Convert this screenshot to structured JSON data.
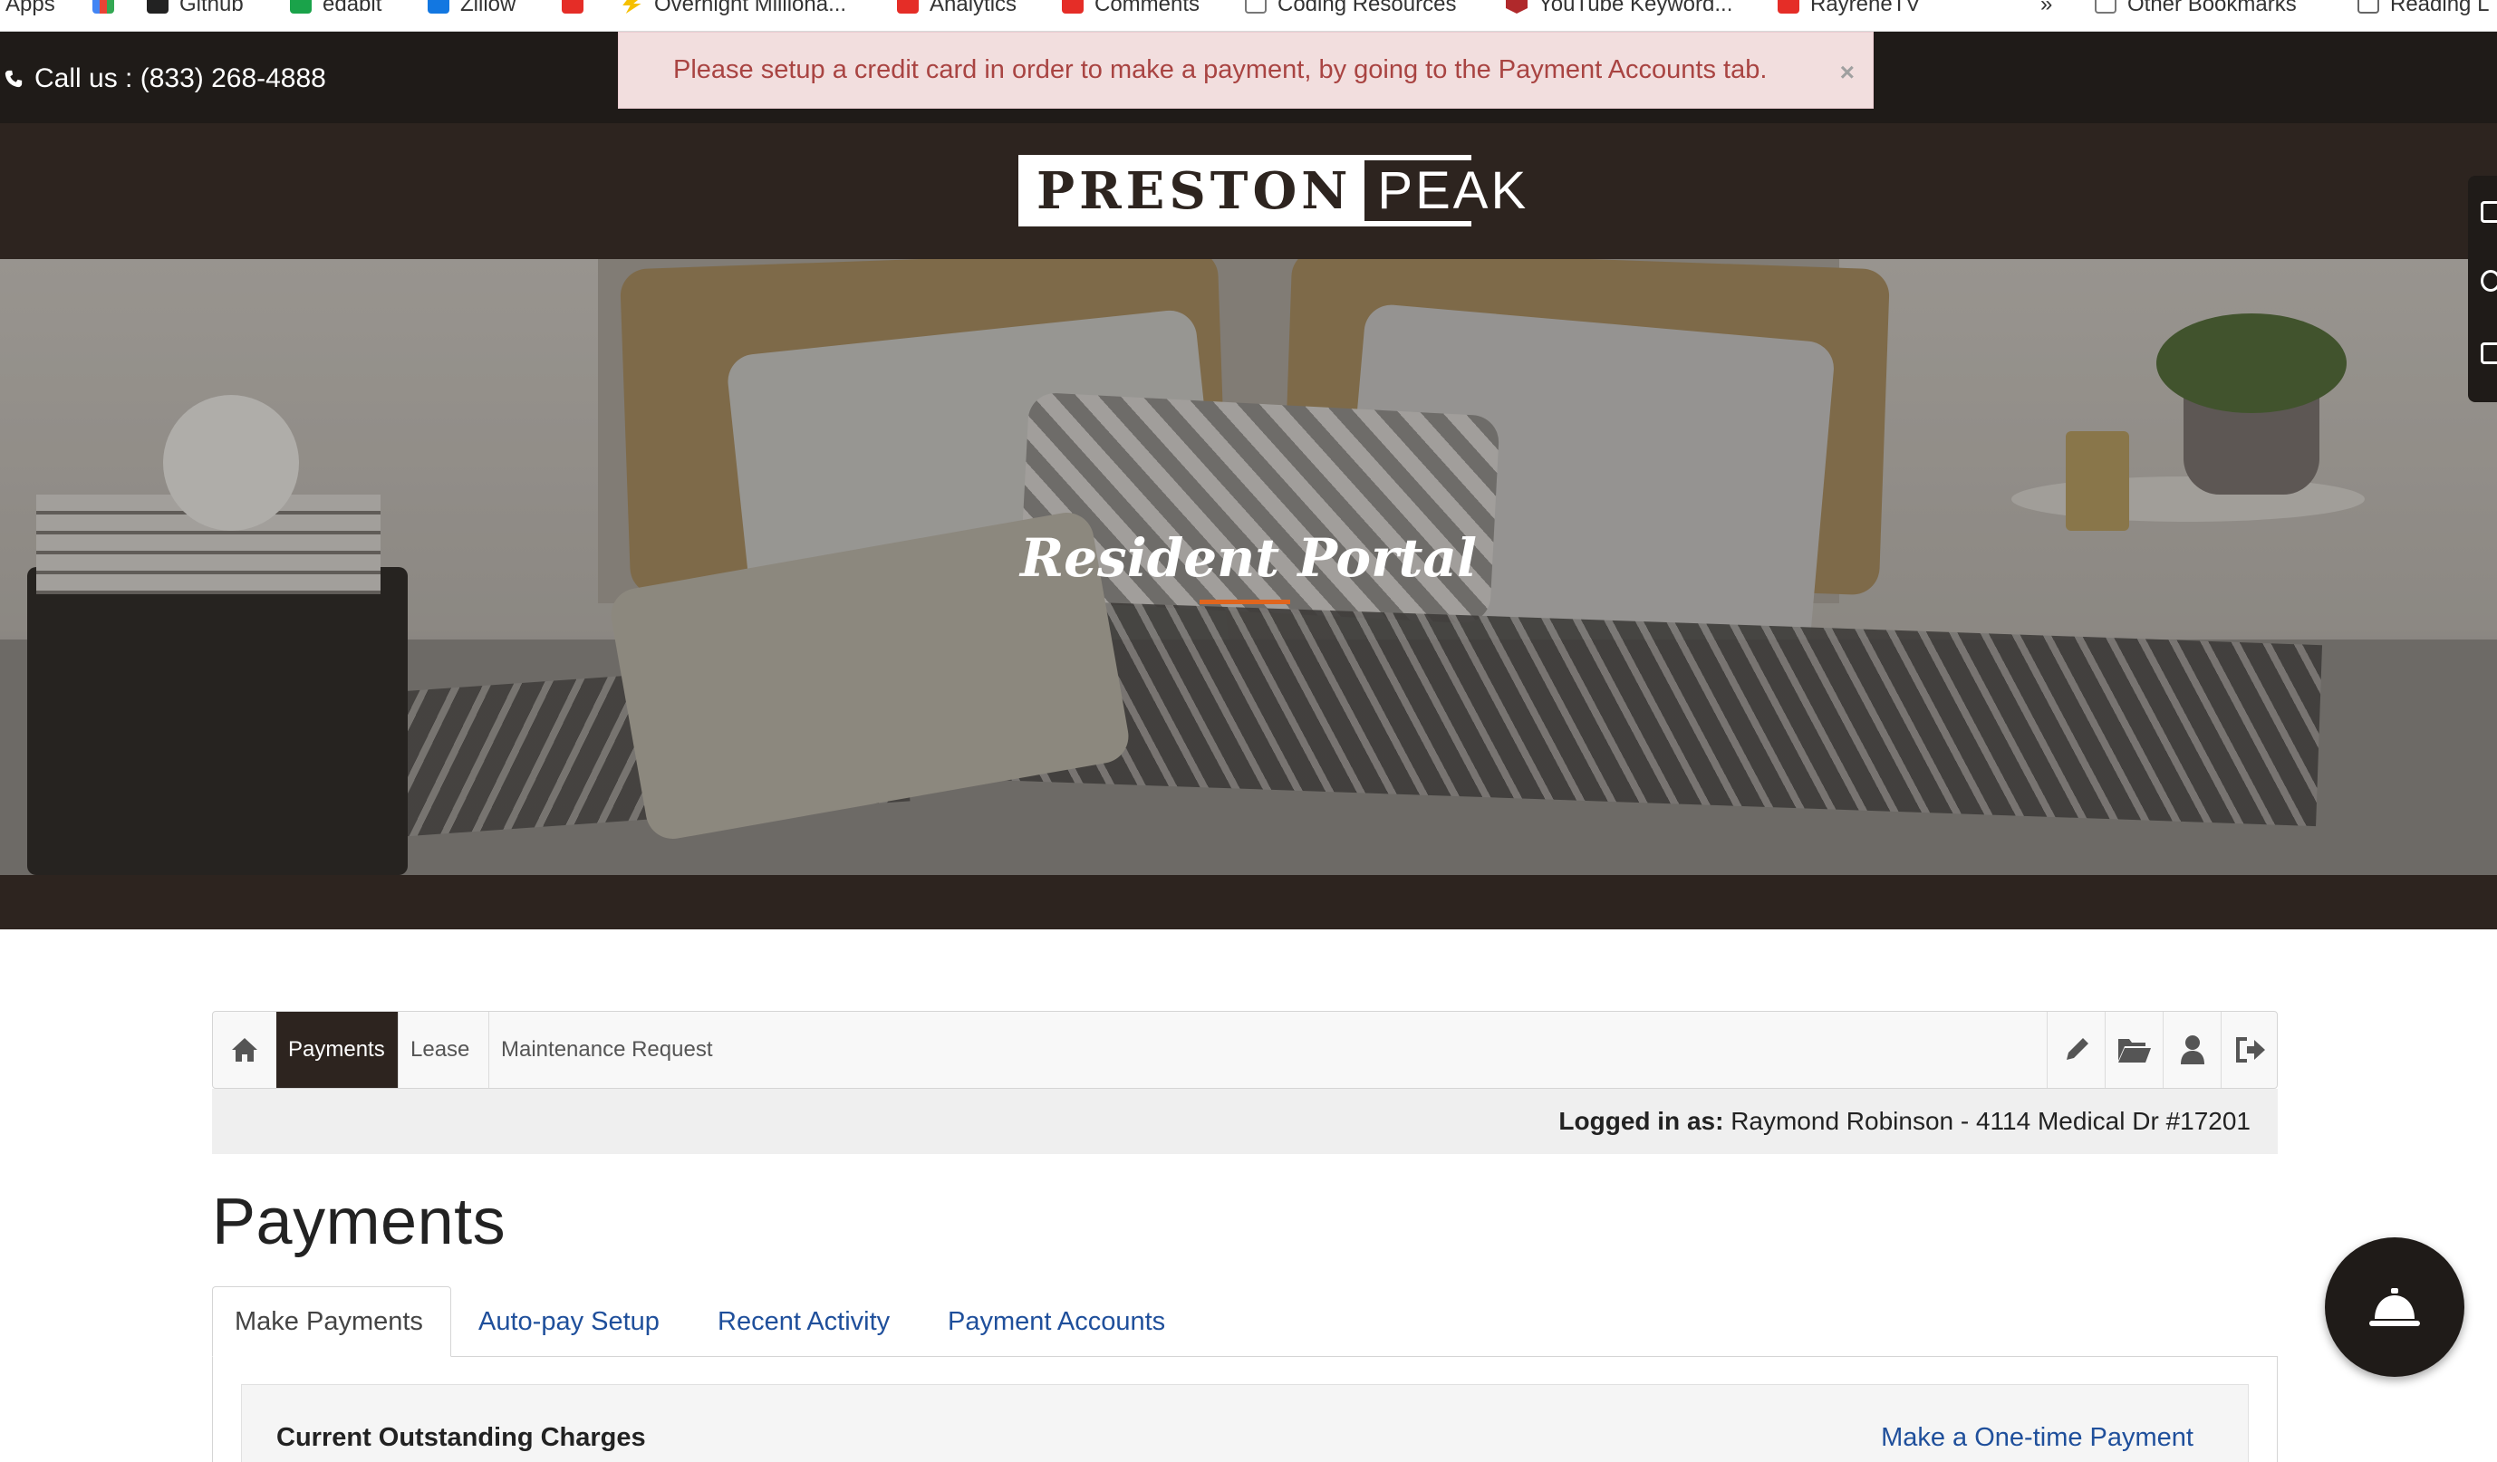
{
  "bookmarks": [
    {
      "label": "Apps",
      "icon": "apps-grid-icon"
    },
    {
      "label": "",
      "icon": "gmail-icon"
    },
    {
      "label": "Github",
      "icon": "github-icon"
    },
    {
      "label": "edabit",
      "icon": "edabit-icon"
    },
    {
      "label": "Zillow",
      "icon": "zillow-icon"
    },
    {
      "label": "",
      "icon": "youtube-icon"
    },
    {
      "label": "Overnight Milliona...",
      "icon": "bolt-icon"
    },
    {
      "label": "Analytics",
      "icon": "youtube-icon"
    },
    {
      "label": "Comments",
      "icon": "youtube-icon"
    },
    {
      "label": "Coding Resources",
      "icon": "folder-icon"
    },
    {
      "label": "YouTube Keyword...",
      "icon": "bookmark-red-icon"
    },
    {
      "label": "RayreneTV",
      "icon": "youtube-icon"
    },
    {
      "label": "»",
      "icon": ""
    },
    {
      "label": "Other Bookmarks",
      "icon": "folder-icon"
    },
    {
      "label": "Reading L",
      "icon": "reading-list-icon"
    }
  ],
  "topbar": {
    "phone": "Call us : (833) 268-4888",
    "alert": "Please setup a credit card in order to make a payment, by going to the Payment Accounts tab.",
    "alert_close": "×"
  },
  "logo": {
    "left": "PRESTON",
    "right": "PEAK"
  },
  "hero": {
    "title": "Resident Portal",
    "accent_color": "#e0651e"
  },
  "nav": {
    "items": [
      {
        "label": "Payments",
        "active": true
      },
      {
        "label": "Lease",
        "active": false
      },
      {
        "label": "Maintenance Request",
        "active": false
      }
    ],
    "right_icons": [
      "pencil-icon",
      "folder-open-icon",
      "user-icon",
      "logout-icon"
    ]
  },
  "logged_in": {
    "prefix": "Logged in as:",
    "value": "Raymond Robinson - 4114 Medical Dr #17201"
  },
  "page": {
    "title": "Payments"
  },
  "tabs": [
    {
      "label": "Make Payments",
      "active": true
    },
    {
      "label": "Auto-pay Setup",
      "active": false
    },
    {
      "label": "Recent Activity",
      "active": false
    },
    {
      "label": "Payment Accounts",
      "active": false
    }
  ],
  "panel": {
    "title": "Current Outstanding Charges",
    "link": "Make a One-time Payment"
  },
  "colors": {
    "dark": "#1f1b18",
    "brand_brown": "#2d241f",
    "link": "#1f4f9b",
    "alert_bg": "#f2dede",
    "alert_text": "#a94442"
  }
}
